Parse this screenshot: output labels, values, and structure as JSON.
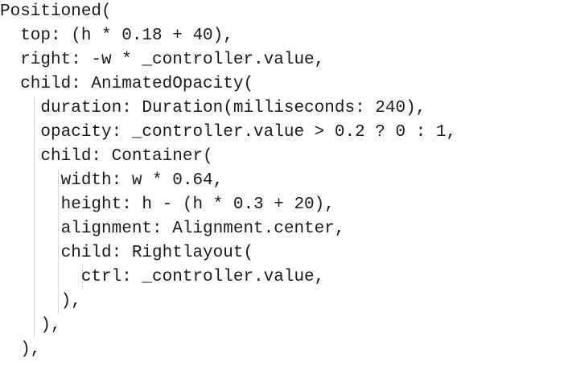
{
  "editor": {
    "lines": [
      "Positioned(",
      "  top: (h * 0.18 + 40),",
      "  right: -w * _controller.value,",
      "  child: AnimatedOpacity(",
      "    duration: Duration(milliseconds: 240),",
      "    opacity: _controller.value > 0.2 ? 0 : 1,",
      "    child: Container(",
      "      width: w * 0.64,",
      "      height: h - (h * 0.3 + 20),",
      "      alignment: Alignment.center,",
      "      child: Rightlayout(",
      "        ctrl: _controller.value,",
      "      ),",
      "    ),",
      "  ),"
    ],
    "text_color": "#1a1a1a",
    "background_color": "#ffffff",
    "indent_guide_color": "#d9d9d9"
  }
}
